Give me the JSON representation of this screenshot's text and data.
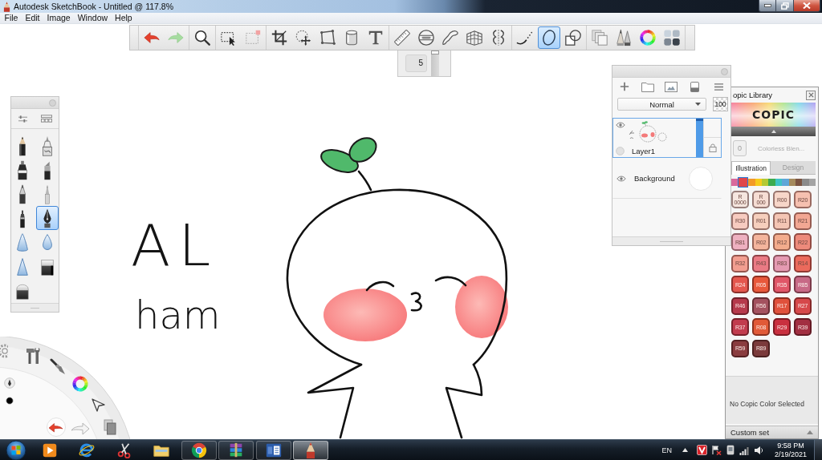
{
  "window": {
    "title": "Autodesk SketchBook - Untitled @ 117.8%"
  },
  "menu": [
    "File",
    "Edit",
    "Image",
    "Window",
    "Help"
  ],
  "toolbar": {
    "groups": [
      [
        {
          "kind": "undo",
          "selected": false
        },
        {
          "kind": "redo",
          "selected": false
        }
      ],
      [
        {
          "kind": "zoom",
          "selected": false
        }
      ],
      [
        {
          "kind": "select",
          "selected": false
        },
        {
          "kind": "select-layer",
          "selected": false
        }
      ],
      [
        {
          "kind": "crop",
          "selected": false
        },
        {
          "kind": "move",
          "selected": false
        },
        {
          "kind": "distort",
          "selected": false
        },
        {
          "kind": "fill",
          "selected": false
        },
        {
          "kind": "text",
          "selected": false
        }
      ],
      [
        {
          "kind": "ruler",
          "selected": false
        },
        {
          "kind": "ellipse-guide",
          "selected": false
        },
        {
          "kind": "french-curve",
          "selected": false
        },
        {
          "kind": "perspective",
          "selected": false
        },
        {
          "kind": "symmetry",
          "selected": false
        }
      ],
      [
        {
          "kind": "stroke",
          "selected": false
        },
        {
          "kind": "ellipse",
          "selected": true
        },
        {
          "kind": "shape",
          "selected": false
        }
      ],
      [
        {
          "kind": "copy",
          "selected": false
        },
        {
          "kind": "brushes",
          "selected": false
        },
        {
          "kind": "color-wheel",
          "selected": false
        },
        {
          "kind": "swatches",
          "selected": false
        }
      ]
    ]
  },
  "brush_size": {
    "value": "5",
    "level": 1
  },
  "brush_panel": {
    "brushes": [
      {
        "kind": "pencil",
        "selected": false
      },
      {
        "kind": "tech-pen",
        "selected": false
      },
      {
        "kind": "marker",
        "selected": false
      },
      {
        "kind": "chisel",
        "selected": false
      },
      {
        "kind": "ballpoint",
        "selected": false
      },
      {
        "kind": "fine-tip",
        "selected": false
      },
      {
        "kind": "felt",
        "selected": false
      },
      {
        "kind": "fountain",
        "selected": true
      },
      {
        "kind": "airbrush",
        "selected": false
      },
      {
        "kind": "droplet",
        "selected": false
      },
      {
        "kind": "blur",
        "selected": false
      },
      {
        "kind": "eraser-hard",
        "selected": false
      },
      {
        "kind": "eraser-soft",
        "selected": false
      }
    ]
  },
  "canvas": {
    "handwriting": [
      "AL",
      "ham"
    ]
  },
  "layers_panel": {
    "blend_mode": "Normal",
    "opacity": "100",
    "layers": [
      {
        "kind": "layer",
        "name": "Layer1",
        "visible": true,
        "selected": true,
        "level": 1
      },
      {
        "kind": "background",
        "name": "Background",
        "visible": true,
        "selected": false
      }
    ]
  },
  "copic_library": {
    "title": "opic Library",
    "logo": "COPIC",
    "blender": {
      "number": "0",
      "name": "Colorless Blen..."
    },
    "tabs": [
      {
        "label": "Illustration",
        "selected": true
      },
      {
        "label": "Design",
        "selected": false
      }
    ],
    "families": [
      {
        "color": "#d9699c",
        "selected": false
      },
      {
        "color": "#e0464a",
        "selected": true
      },
      {
        "color": "#f39a27",
        "selected": false
      },
      {
        "color": "#f6cb1c",
        "selected": false
      },
      {
        "color": "#b3c934",
        "selected": false
      },
      {
        "color": "#3cab4f",
        "selected": false
      },
      {
        "color": "#3ec3c5",
        "selected": false
      },
      {
        "color": "#5ea6d8",
        "selected": false
      },
      {
        "color": "#a58a5d",
        "selected": false
      },
      {
        "color": "#7b5442",
        "selected": false
      },
      {
        "color": "#8b8b8b",
        "selected": false
      },
      {
        "color": "#a4a4a4",
        "selected": false
      }
    ],
    "colors": [
      {
        "label": "R 0000",
        "color": "#f5e6df"
      },
      {
        "label": "R 000",
        "color": "#f6ddd4"
      },
      {
        "label": "R00",
        "color": "#f7d6c9"
      },
      {
        "label": "R20",
        "color": "#f6c0b0"
      },
      {
        "label": "R30",
        "color": "#f7cbc0"
      },
      {
        "label": "R01",
        "color": "#f6cfbd"
      },
      {
        "label": "R11",
        "color": "#f4c5b4"
      },
      {
        "label": "R21",
        "color": "#f2a793"
      },
      {
        "label": "R81",
        "color": "#eeb0c0"
      },
      {
        "label": "R02",
        "color": "#f4b59d"
      },
      {
        "label": "R12",
        "color": "#f3ac8d"
      },
      {
        "label": "R22",
        "color": "#ed8a7b"
      },
      {
        "label": "R32",
        "color": "#f29e90"
      },
      {
        "label": "R43",
        "color": "#ea7a84"
      },
      {
        "label": "R83",
        "color": "#e59ab2"
      },
      {
        "label": "R14",
        "color": "#eb6a5c"
      },
      {
        "label": "R24",
        "color": "#e4574e"
      },
      {
        "label": "R05",
        "color": "#e8583b"
      },
      {
        "label": "R35",
        "color": "#e05668"
      },
      {
        "label": "R85",
        "color": "#c76986"
      },
      {
        "label": "R46",
        "color": "#b63a4c"
      },
      {
        "label": "R56",
        "color": "#a4525f"
      },
      {
        "label": "R17",
        "color": "#e0513c"
      },
      {
        "label": "R27",
        "color": "#d6484a"
      },
      {
        "label": "R37",
        "color": "#c23c4e"
      },
      {
        "label": "R08",
        "color": "#e15a38"
      },
      {
        "label": "R29",
        "color": "#c9303f"
      },
      {
        "label": "R39",
        "color": "#a22f41"
      },
      {
        "label": "R59",
        "color": "#8a3c3f"
      },
      {
        "label": "R89",
        "color": "#7b3a3b"
      }
    ],
    "status": "No Copic Color Selected",
    "custom_set": "Custom set"
  },
  "taskbar": {
    "apps": [
      {
        "kind": "media",
        "running": false,
        "selected": false
      },
      {
        "kind": "ie",
        "running": false,
        "selected": false
      },
      {
        "kind": "snip",
        "running": false,
        "selected": false
      },
      {
        "kind": "explorer",
        "running": false,
        "selected": false
      },
      {
        "kind": "chrome",
        "running": true,
        "selected": false
      },
      {
        "kind": "archive",
        "running": true,
        "selected": false
      },
      {
        "kind": "word",
        "running": true,
        "selected": false
      },
      {
        "kind": "sketchbook",
        "running": true,
        "selected": true
      }
    ],
    "language": "EN",
    "time": "9:58 PM",
    "date": "2/19/2021"
  }
}
